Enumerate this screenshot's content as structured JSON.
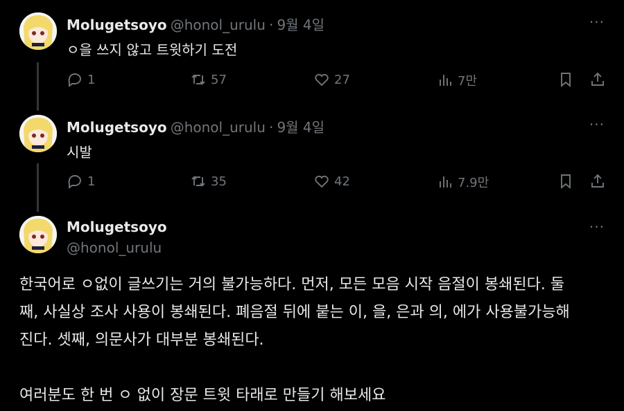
{
  "tweets": [
    {
      "name": "Molugetsoyo",
      "handle": "@honol_urulu",
      "separator": "·",
      "date": "9월 4일",
      "text": "ㅇ을 쓰지 않고 트윗하기 도전",
      "replies": "1",
      "retweets": "57",
      "likes": "27",
      "views": "7만"
    },
    {
      "name": "Molugetsoyo",
      "handle": "@honol_urulu",
      "separator": "·",
      "date": "9월 4일",
      "text": "시발",
      "replies": "1",
      "retweets": "35",
      "likes": "42",
      "views": "7.9만"
    }
  ],
  "main": {
    "name": "Molugetsoyo",
    "handle": "@honol_urulu",
    "line1": "한국어로 ㅇ없이 글쓰기는 거의 불가능하다. 먼저, 모든 모음 시작 음절이 봉쇄된다. 둘",
    "line2": "째, 사실상 조사 사용이 봉쇄된다. 폐음절 뒤에 붙는 이, 을, 은과 의, 에가 사용불가능해",
    "line3": "진다. 셋째, 의문사가 대부분 봉쇄된다.",
    "line4": "여러분도 한 번 ㅇ 없이 장문 트윗 타래로 만들기 해보세요"
  },
  "more_label": "···",
  "colors": {
    "background": "#000000",
    "text": "#e7e9ea",
    "muted": "#71767b",
    "line": "#333639"
  }
}
